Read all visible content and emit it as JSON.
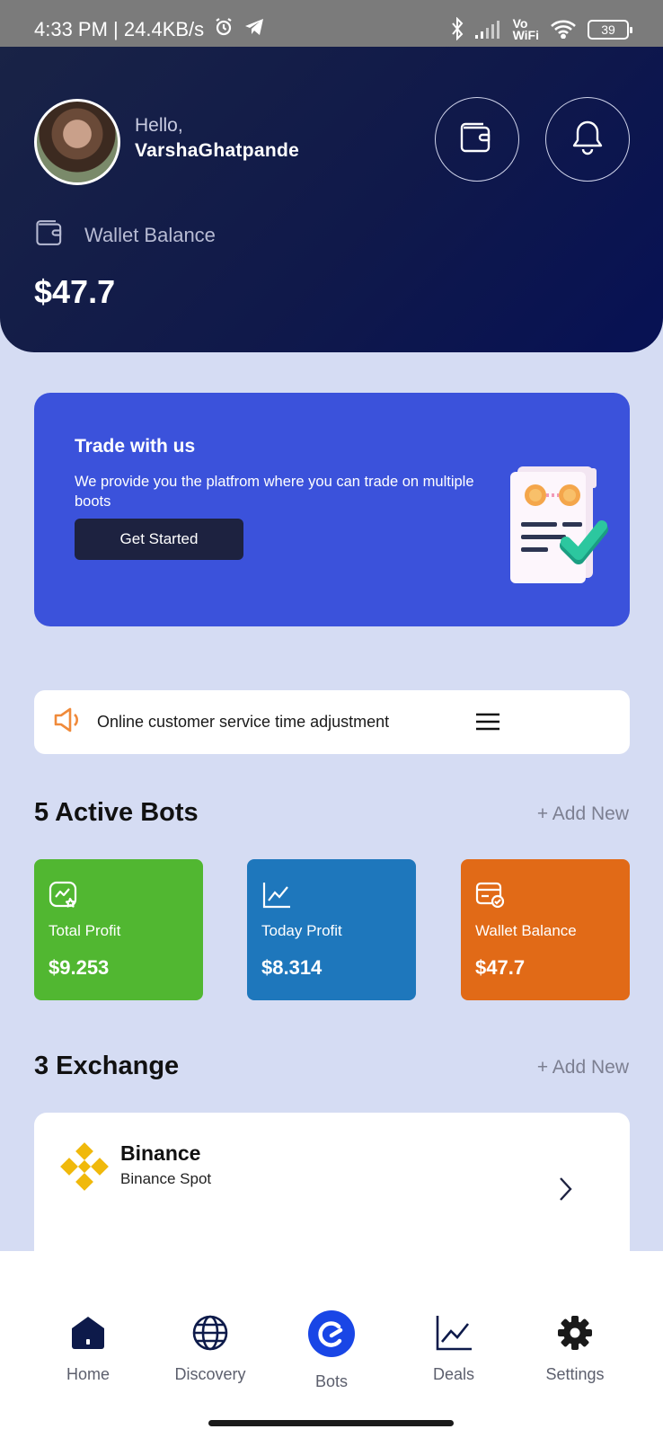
{
  "status": {
    "time_speed": "4:33 PM | 24.4KB/s",
    "volte": "Vo",
    "wifi": "WiFi",
    "battery": "39"
  },
  "header": {
    "greeting": "Hello,",
    "username": "VarshaGhatpande",
    "wallet_label": "Wallet Balance",
    "wallet_balance": "$47.7"
  },
  "promo": {
    "title": "Trade with us",
    "description": "We provide you the platfrom where you can trade on multiple boots",
    "cta": "Get Started"
  },
  "notice": {
    "text": "Online customer service time adjustment"
  },
  "bots": {
    "title": "5 Active Bots",
    "add_new": "+ Add New",
    "cards": [
      {
        "label": "Total Profit",
        "value": "$9.253",
        "color": "#51b731",
        "icon": "chart-star-icon"
      },
      {
        "label": "Today Profit",
        "value": "$8.314",
        "color": "#1e77bc",
        "icon": "line-chart-icon"
      },
      {
        "label": "Wallet Balance",
        "value": "$47.7",
        "color": "#e16a17",
        "icon": "card-check-icon"
      }
    ]
  },
  "exchange": {
    "title": "3 Exchange",
    "add_new": "+ Add New",
    "items": [
      {
        "name": "Binance",
        "subtitle": "Binance Spot"
      }
    ]
  },
  "nav": {
    "items": [
      {
        "label": "Home",
        "icon": "home-icon"
      },
      {
        "label": "Discovery",
        "icon": "globe-icon"
      },
      {
        "label": "Bots",
        "icon": "bots-icon",
        "active": true
      },
      {
        "label": "Deals",
        "icon": "line-chart-icon"
      },
      {
        "label": "Settings",
        "icon": "gear-icon"
      }
    ]
  },
  "colors": {
    "header": "#0f1a4a",
    "background": "#d5dcf3",
    "promo": "#3b52db",
    "accent_blue": "#1946e6",
    "notice_orange": "#f08a3a"
  }
}
